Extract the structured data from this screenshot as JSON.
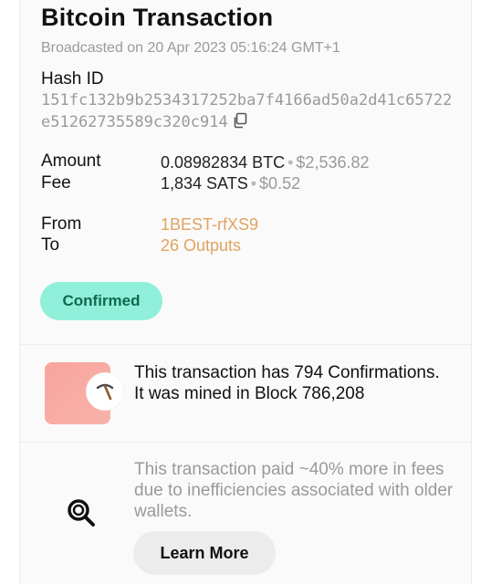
{
  "header": {
    "title": "Bitcoin Transaction",
    "broadcasted": "Broadcasted on 20 Apr 2023 05:16:24 GMT+1"
  },
  "hash": {
    "label": "Hash ID",
    "value": "151fc132b9b2534317252ba7f4166ad50a2d41c65722e51262735589c320c914",
    "copy_icon": "copy-icon"
  },
  "amount": {
    "label": "Amount",
    "btc": "0.08982834 BTC",
    "usd": "$2,536.82"
  },
  "fee": {
    "label": "Fee",
    "sats": "1,834 SATS",
    "usd": "$0.52"
  },
  "from": {
    "label": "From",
    "value": "1BEST-rfXS9"
  },
  "to": {
    "label": "To",
    "value": "26 Outputs"
  },
  "status": {
    "label": "Confirmed",
    "color": "#90efd8"
  },
  "confirmations": {
    "text": "This transaction has 794 Confirmations. It was mined in Block 786,208",
    "icon": "pickaxe-icon"
  },
  "efficiency": {
    "text": "This transaction paid ~40% more in fees due to inefficiencies associated with older wallets.",
    "icon": "magnifier-icon",
    "button_label": "Learn More"
  },
  "colors": {
    "accent_link": "#e0a35f",
    "badge_bg": "#90efd8",
    "badge_text": "#10684f",
    "block_tile": "#f9a49d"
  }
}
